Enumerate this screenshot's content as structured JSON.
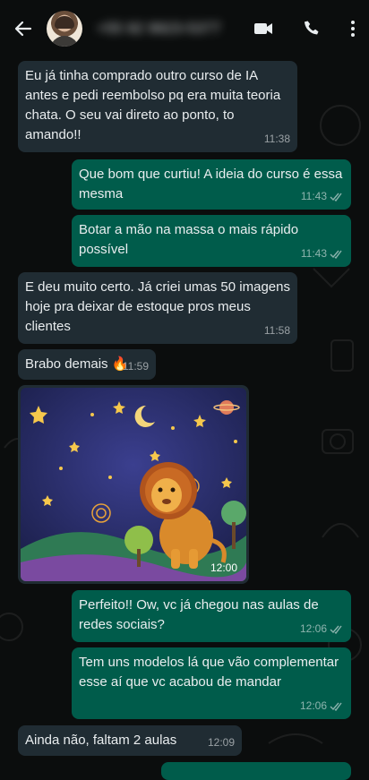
{
  "header": {
    "contact_name": "+55 92 9923-5377",
    "back_icon": "arrow-left-icon",
    "video_icon": "video-camera-icon",
    "call_icon": "phone-icon",
    "menu_icon": "more-vertical-icon"
  },
  "messages": [
    {
      "dir": "in",
      "text": "Eu já tinha comprado outro curso de IA antes e pedi reembolso pq era muita teoria chata. O seu vai direto ao ponto, to amando!!",
      "time": "11:38"
    },
    {
      "dir": "out",
      "text": "Que bom que curtiu! A ideia do curso é essa mesma",
      "time": "11:43",
      "status": "read"
    },
    {
      "dir": "out",
      "text": "Botar a mão na massa o mais rápido possível",
      "time": "11:43",
      "status": "read"
    },
    {
      "dir": "in",
      "text": "E deu muito certo. Já criei umas 50 imagens hoje pra deixar de estoque pros meus clientes",
      "time": "11:58"
    },
    {
      "dir": "in",
      "text": "Brabo demais 🔥",
      "time": "11:59"
    },
    {
      "dir": "in",
      "type": "image",
      "image": "lion-illustration",
      "time": "12:00"
    },
    {
      "dir": "out",
      "text": "Perfeito!! Ow, vc já chegou nas aulas de redes sociais?",
      "time": "12:06",
      "status": "read"
    },
    {
      "dir": "out",
      "text": "Tem uns modelos lá que vão complementar esse aí que vc acabou de mandar",
      "time": "12:06",
      "status": "read"
    },
    {
      "dir": "in",
      "text": "Ainda não, faltam 2 aulas",
      "time": "12:09"
    }
  ],
  "colors": {
    "background": "#0b0d0d",
    "incoming_bubble": "#202c33",
    "outgoing_bubble": "#005c4b",
    "text": "#e9edef"
  }
}
